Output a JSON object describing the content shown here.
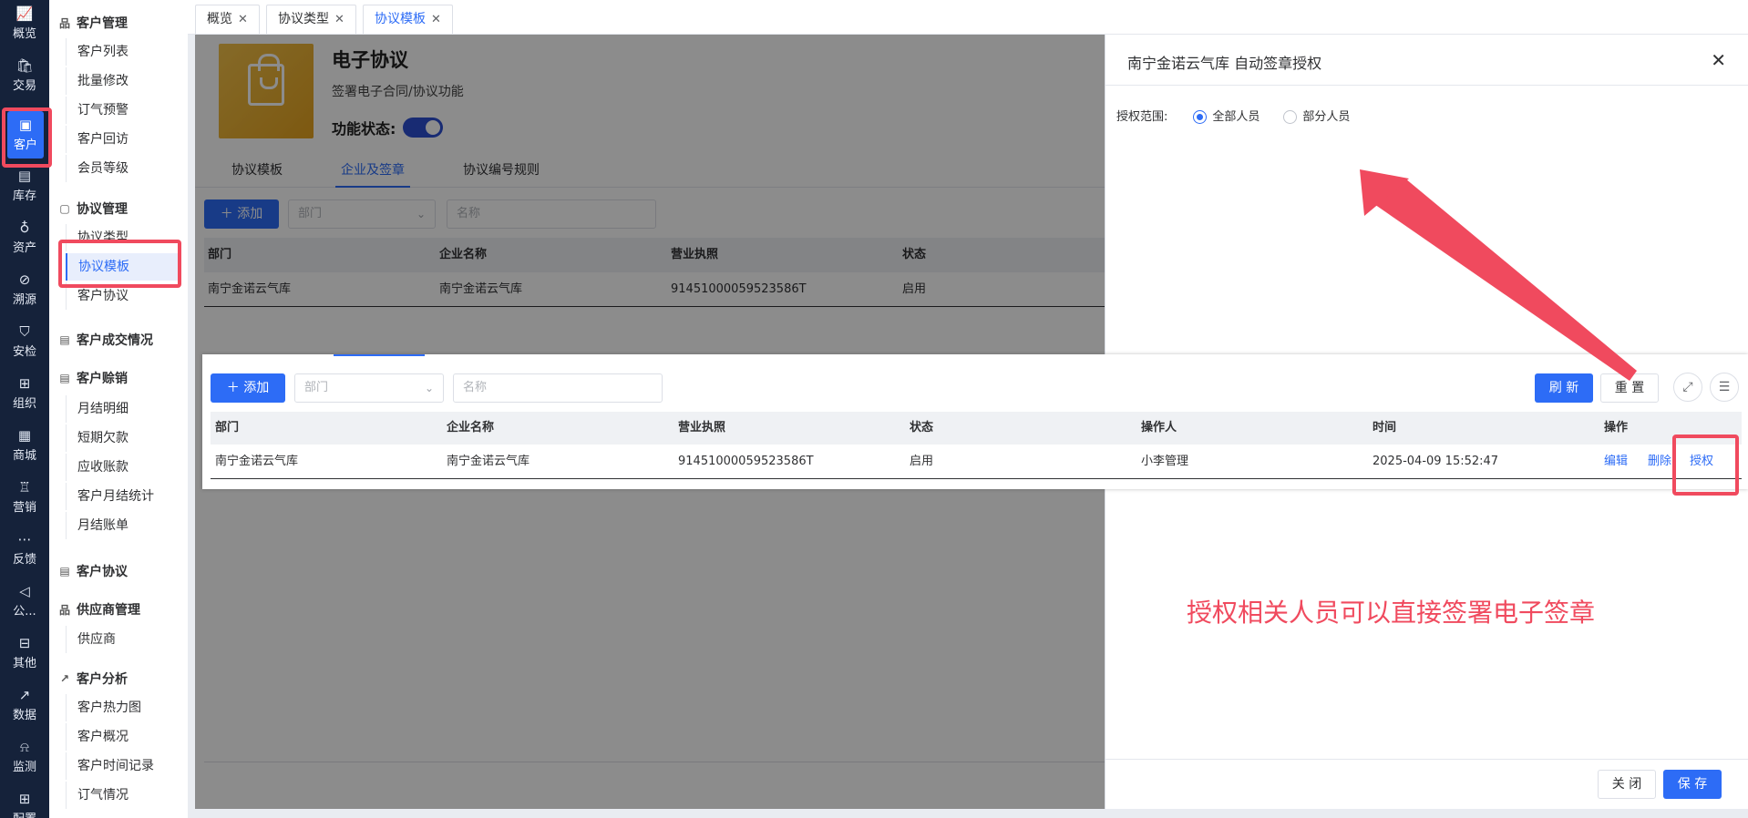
{
  "rail": [
    {
      "label": "概览",
      "icon": "chart-line-icon",
      "glyph": "📈"
    },
    {
      "label": "交易",
      "icon": "bag-icon",
      "glyph": "🛍"
    },
    {
      "label": "客户",
      "icon": "id-card-icon",
      "glyph": "▣"
    },
    {
      "label": "库存",
      "icon": "list-box-icon",
      "glyph": "▤"
    },
    {
      "label": "资产",
      "icon": "bulb-icon",
      "glyph": "♁"
    },
    {
      "label": "溯源",
      "icon": "compass-icon",
      "glyph": "⊘"
    },
    {
      "label": "安检",
      "icon": "shield-icon",
      "glyph": "⛉"
    },
    {
      "label": "组织",
      "icon": "org-icon",
      "glyph": "⊞"
    },
    {
      "label": "商城",
      "icon": "store-icon",
      "glyph": "▦"
    },
    {
      "label": "营销",
      "icon": "trophy-icon",
      "glyph": "♖"
    },
    {
      "label": "反馈",
      "icon": "chat-icon",
      "glyph": "⋯"
    },
    {
      "label": "公...",
      "icon": "megaphone-icon",
      "glyph": "◁"
    },
    {
      "label": "其他",
      "icon": "blocks-icon",
      "glyph": "⊟"
    },
    {
      "label": "数据",
      "icon": "trend-icon",
      "glyph": "↗"
    },
    {
      "label": "监测",
      "icon": "alarm-icon",
      "glyph": "⍾"
    },
    {
      "label": "配置",
      "icon": "grid-icon",
      "glyph": "⊞"
    }
  ],
  "submenu": {
    "groups": [
      {
        "label": "客户管理",
        "icon": "tree-icon"
      },
      {
        "label": "协议管理",
        "icon": "copy-icon"
      },
      {
        "label": "客户成交情况",
        "icon": "doc-icon"
      },
      {
        "label": "客户赊销",
        "icon": "doc-icon"
      },
      {
        "label": "客户协议",
        "icon": "doc-icon"
      },
      {
        "label": "供应商管理",
        "icon": "tree-icon"
      },
      {
        "label": "客户分析",
        "icon": "chart-icon"
      }
    ],
    "items": [
      "客户列表",
      "批量修改",
      "订气预警",
      "客户回访",
      "会员等级",
      "协议类型",
      "协议模板",
      "客户协议",
      "月结明细",
      "短期欠款",
      "应收账款",
      "客户月结统计",
      "月结账单",
      "供应商",
      "客户热力图",
      "客户概况",
      "客户时间记录",
      "订气情况"
    ]
  },
  "tabs": [
    {
      "label": "概览"
    },
    {
      "label": "协议类型"
    },
    {
      "label": "协议模板"
    }
  ],
  "feature": {
    "title": "电子协议",
    "desc": "签署电子合同/协议功能",
    "status_label": "功能状态:"
  },
  "subtabs": [
    "协议模板",
    "企业及签章",
    "协议编号规则"
  ],
  "toolbar": {
    "add_label": "添加",
    "dept_placeholder": "部门",
    "name_placeholder": "名称",
    "refresh_label": "刷 新",
    "reset_label": "重 置"
  },
  "table": {
    "headers": [
      "部门",
      "企业名称",
      "营业执照",
      "状态",
      "操作人",
      "时间",
      "操作"
    ],
    "row": {
      "dept": "南宁金诺云气库",
      "company": "南宁金诺云气库",
      "license": "91451000059523586T",
      "status": "启用",
      "operator": "小李管理",
      "time": "2025-04-09 15:52:47",
      "actions": [
        "编辑",
        "删除",
        "授权"
      ]
    }
  },
  "drawer": {
    "title": "南宁金诺云气库 自动签章授权",
    "scope_label": "授权范围:",
    "options": [
      "全部人员",
      "部分人员"
    ],
    "selected": "全部人员",
    "close_label": "关 闭",
    "save_label": "保 存"
  },
  "annotation": "授权相关人员可以直接签署电子签章",
  "colors": {
    "accent": "#2d6cf6",
    "highlight": "#f04a5e",
    "rail_bg": "#15223a"
  }
}
